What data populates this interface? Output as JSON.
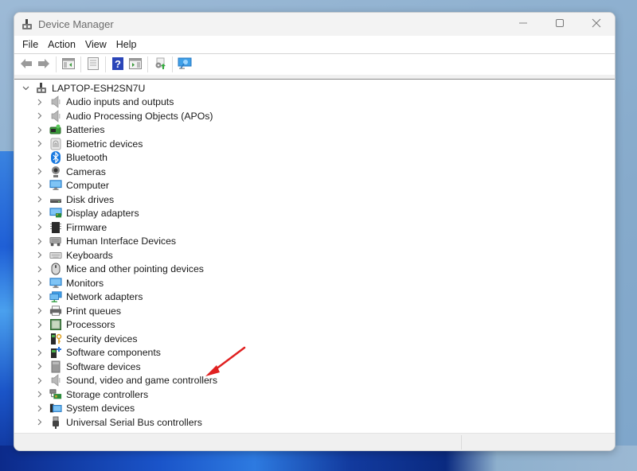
{
  "window": {
    "title": "Device Manager",
    "title_icon": "device-manager-icon",
    "controls": {
      "minimize_icon": "minimize-icon",
      "maximize_icon": "maximize-icon",
      "close_icon": "close-icon"
    }
  },
  "menubar": {
    "items": [
      {
        "label": "File"
      },
      {
        "label": "Action"
      },
      {
        "label": "View"
      },
      {
        "label": "Help"
      }
    ]
  },
  "toolbar": {
    "buttons": [
      {
        "icon": "back-arrow-icon",
        "enabled": false
      },
      {
        "icon": "forward-arrow-icon",
        "enabled": false
      },
      {
        "icon": "show-hide-console-tree-icon",
        "enabled": true
      },
      {
        "icon": "properties-icon",
        "enabled": false
      },
      {
        "icon": "help-icon",
        "enabled": true
      },
      {
        "icon": "show-action-pane-icon",
        "enabled": true
      },
      {
        "icon": "update-driver-icon",
        "enabled": false
      },
      {
        "icon": "scan-hardware-changes-icon",
        "enabled": true
      }
    ]
  },
  "tree": {
    "root": {
      "label": "LAPTOP-ESH2SN7U",
      "icon": "computer-root-icon",
      "expanded": true
    },
    "categories": [
      {
        "label": "Audio inputs and outputs",
        "icon": "speaker-icon"
      },
      {
        "label": "Audio Processing Objects (APOs)",
        "icon": "speaker-icon"
      },
      {
        "label": "Batteries",
        "icon": "battery-icon"
      },
      {
        "label": "Biometric devices",
        "icon": "fingerprint-icon"
      },
      {
        "label": "Bluetooth",
        "icon": "bluetooth-icon"
      },
      {
        "label": "Cameras",
        "icon": "camera-icon"
      },
      {
        "label": "Computer",
        "icon": "monitor-icon"
      },
      {
        "label": "Disk drives",
        "icon": "disk-drive-icon"
      },
      {
        "label": "Display adapters",
        "icon": "display-adapter-icon"
      },
      {
        "label": "Firmware",
        "icon": "firmware-icon"
      },
      {
        "label": "Human Interface Devices",
        "icon": "hid-icon"
      },
      {
        "label": "Keyboards",
        "icon": "keyboard-icon"
      },
      {
        "label": "Mice and other pointing devices",
        "icon": "mouse-icon"
      },
      {
        "label": "Monitors",
        "icon": "monitor-icon"
      },
      {
        "label": "Network adapters",
        "icon": "network-adapter-icon"
      },
      {
        "label": "Print queues",
        "icon": "printer-icon"
      },
      {
        "label": "Processors",
        "icon": "processor-icon"
      },
      {
        "label": "Security devices",
        "icon": "security-device-icon"
      },
      {
        "label": "Software components",
        "icon": "software-component-icon"
      },
      {
        "label": "Software devices",
        "icon": "software-device-icon"
      },
      {
        "label": "Sound, video and game controllers",
        "icon": "speaker-icon"
      },
      {
        "label": "Storage controllers",
        "icon": "storage-controller-icon"
      },
      {
        "label": "System devices",
        "icon": "system-devices-icon"
      },
      {
        "label": "Universal Serial Bus controllers",
        "icon": "usb-icon"
      }
    ]
  },
  "annotation": {
    "type": "red-arrow",
    "points_to": "Sound, video and game controllers",
    "color": "#e02020"
  },
  "colors": {
    "accent_arrow": "#e02020",
    "title_text": "#6b6b6b"
  }
}
